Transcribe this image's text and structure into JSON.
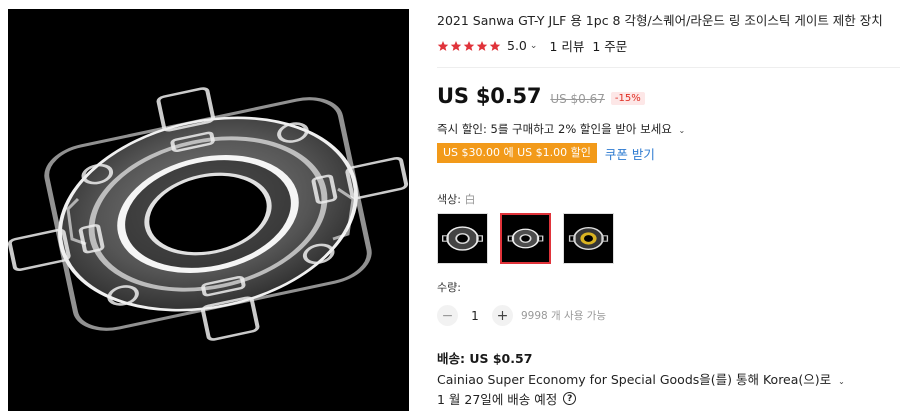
{
  "product": {
    "title": "2021 Sanwa GT-Y JLF 용 1pc 8 각형/스퀘어/라운드 링 조이스틱 게이트 제한 장치",
    "image_alt": "투명 조이스틱 게이트 링"
  },
  "rating": {
    "value": "5.0",
    "stars": 5,
    "star_color": "#e0333a",
    "reviews": "1 리뷰",
    "orders": "1 주문"
  },
  "price": {
    "current": "US $0.57",
    "original": "US $0.67",
    "discount": "-15%"
  },
  "promo": {
    "instant_discount": "즉시 할인: 5를 구매하고 2% 할인을 받아 보세요",
    "coupon_badge": "US $30.00 에 US $1.00 할인",
    "coupon_link": "쿠폰 받기",
    "badge_color": "#f29a1a"
  },
  "color": {
    "label": "색상:",
    "selected_value": "白",
    "options": [
      "octagon-clear",
      "round-clear",
      "square-yellow"
    ],
    "selected_index": 1
  },
  "quantity": {
    "label": "수량:",
    "value": "1",
    "minus": "−",
    "plus": "+",
    "available": "9998 개 사용 가능"
  },
  "shipping": {
    "label": "배송:",
    "price": "US $0.57",
    "method": "Cainiao Super Economy for Special Goods을(를) 통해 Korea(으)로",
    "date_highlight": "1 월 27일",
    "date_suffix": "에 배송 예정",
    "help_glyph": "?"
  }
}
